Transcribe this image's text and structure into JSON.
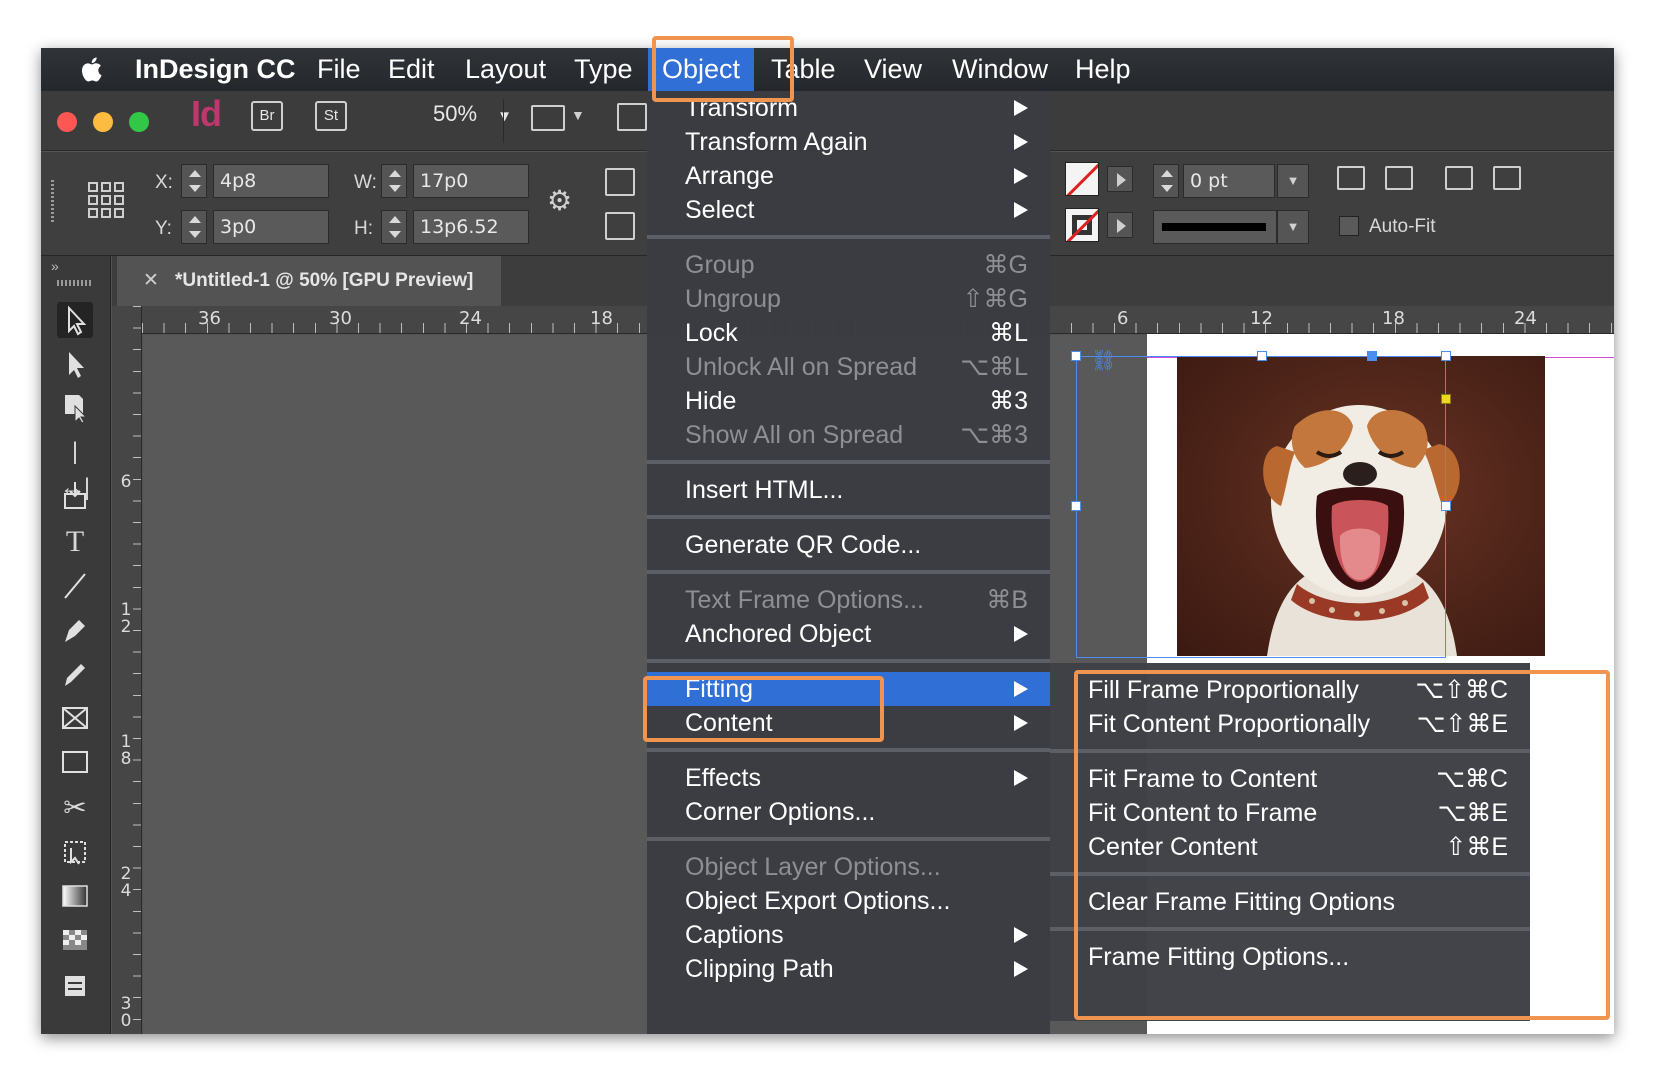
{
  "menubar": {
    "app_name": "InDesign CC",
    "items": [
      "File",
      "Edit",
      "Layout",
      "Type",
      "Object",
      "Table",
      "View",
      "Window",
      "Help"
    ],
    "active": "Object"
  },
  "toolbar": {
    "app_icon": "Id",
    "bridge_label": "Br",
    "stock_label": "St",
    "zoom": "50%"
  },
  "control_panel": {
    "x_label": "X:",
    "x_value": "4p8",
    "y_label": "Y:",
    "y_value": "3p0",
    "w_label": "W:",
    "w_value": "17p0",
    "h_label": "H:",
    "h_value": "13p6.52",
    "stroke_weight": "0 pt",
    "auto_fit_label": "Auto-Fit"
  },
  "document_tab": {
    "title": "*Untitled-1 @ 50% [GPU Preview]"
  },
  "ruler": {
    "h_labels_left": [
      "36",
      "30",
      "24",
      "18"
    ],
    "h_labels_right": [
      "6",
      "12",
      "18",
      "24"
    ],
    "v_labels": [
      "6",
      "12",
      "18",
      "24",
      "30"
    ]
  },
  "object_menu": {
    "items": [
      {
        "label": "Transform",
        "shortcut": "",
        "submenu": true,
        "disabled": false
      },
      {
        "label": "Transform Again",
        "shortcut": "",
        "submenu": true,
        "disabled": false
      },
      {
        "label": "Arrange",
        "shortcut": "",
        "submenu": true,
        "disabled": false
      },
      {
        "label": "Select",
        "shortcut": "",
        "submenu": true,
        "disabled": false
      },
      {
        "label": "Group",
        "shortcut": "⌘G",
        "submenu": false,
        "disabled": true
      },
      {
        "label": "Ungroup",
        "shortcut": "⇧⌘G",
        "submenu": false,
        "disabled": true
      },
      {
        "label": "Lock",
        "shortcut": "⌘L",
        "submenu": false,
        "disabled": false
      },
      {
        "label": "Unlock All on Spread",
        "shortcut": "⌥⌘L",
        "submenu": false,
        "disabled": true
      },
      {
        "label": "Hide",
        "shortcut": "⌘3",
        "submenu": false,
        "disabled": false
      },
      {
        "label": "Show All on Spread",
        "shortcut": "⌥⌘3",
        "submenu": false,
        "disabled": true
      },
      {
        "label": "Insert HTML...",
        "shortcut": "",
        "submenu": false,
        "disabled": false
      },
      {
        "label": "Generate QR Code...",
        "shortcut": "",
        "submenu": false,
        "disabled": false
      },
      {
        "label": "Text Frame Options...",
        "shortcut": "⌘B",
        "submenu": false,
        "disabled": true
      },
      {
        "label": "Anchored Object",
        "shortcut": "",
        "submenu": true,
        "disabled": false
      },
      {
        "label": "Fitting",
        "shortcut": "",
        "submenu": true,
        "disabled": false
      },
      {
        "label": "Content",
        "shortcut": "",
        "submenu": true,
        "disabled": false
      },
      {
        "label": "Effects",
        "shortcut": "",
        "submenu": true,
        "disabled": false
      },
      {
        "label": "Corner Options...",
        "shortcut": "",
        "submenu": false,
        "disabled": false
      },
      {
        "label": "Object Layer Options...",
        "shortcut": "",
        "submenu": false,
        "disabled": true
      },
      {
        "label": "Object Export Options...",
        "shortcut": "",
        "submenu": false,
        "disabled": false
      },
      {
        "label": "Captions",
        "shortcut": "",
        "submenu": true,
        "disabled": false
      },
      {
        "label": "Clipping Path",
        "shortcut": "",
        "submenu": true,
        "disabled": false
      }
    ],
    "highlighted": "Fitting"
  },
  "fitting_submenu": {
    "items": [
      {
        "label": "Fill Frame Proportionally",
        "shortcut": "⌥⇧⌘C"
      },
      {
        "label": "Fit Content Proportionally",
        "shortcut": "⌥⇧⌘E"
      },
      {
        "label": "Fit Frame to Content",
        "shortcut": "⌥⌘C"
      },
      {
        "label": "Fit Content to Frame",
        "shortcut": "⌥⌘E"
      },
      {
        "label": "Center Content",
        "shortcut": "⇧⌘E"
      },
      {
        "label": "Clear Frame Fitting Options",
        "shortcut": ""
      },
      {
        "label": "Frame Fitting Options...",
        "shortcut": ""
      }
    ]
  },
  "colors": {
    "menu_highlight": "#2f6fd6",
    "callout": "#f0954f",
    "app_icon": "#c0366e",
    "selection": "#4a8ef0"
  }
}
